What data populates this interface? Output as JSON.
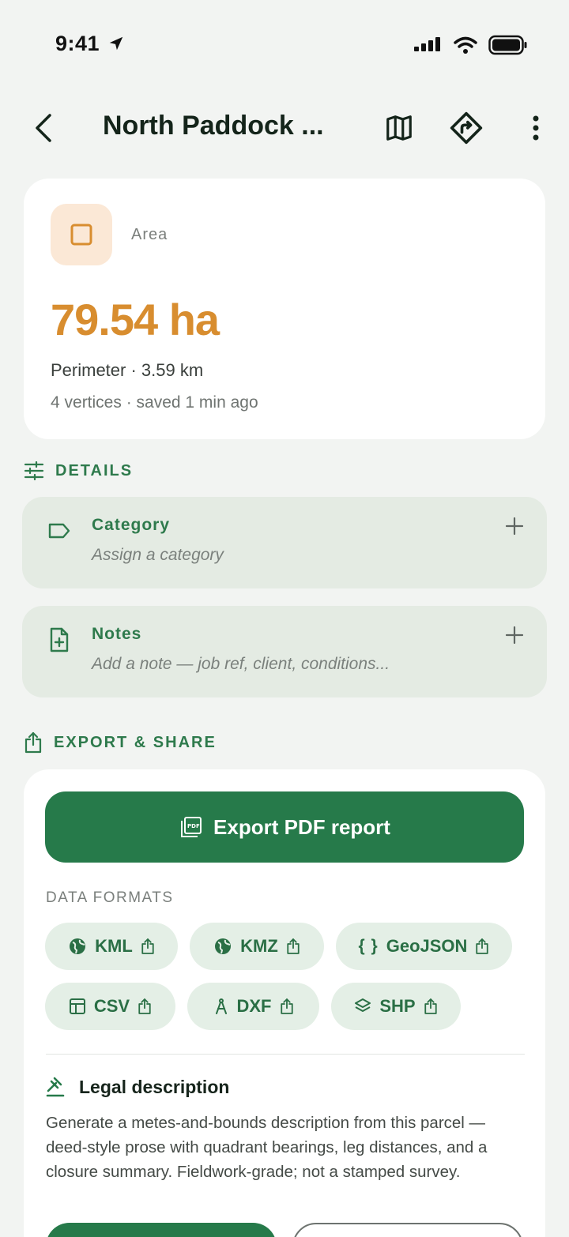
{
  "status": {
    "time": "9:41"
  },
  "header": {
    "title": "North Paddock ..."
  },
  "summary": {
    "label": "Area",
    "value": "79.54 ha",
    "perimeter": "Perimeter · 3.59 km",
    "meta": "4 vertices · saved 1 min ago"
  },
  "details": {
    "heading": "DETAILS",
    "category": {
      "title": "Category",
      "placeholder": "Assign a category"
    },
    "notes": {
      "title": "Notes",
      "placeholder": "Add a note — job ref, client, conditions..."
    }
  },
  "export": {
    "heading": "EXPORT & SHARE",
    "pdf_label": "Export PDF report",
    "formats_label": "DATA FORMATS",
    "formats": [
      "KML",
      "KMZ",
      "GeoJSON",
      "CSV",
      "DXF",
      "SHP"
    ],
    "legal_title": "Legal description",
    "legal_text": "Generate a metes-and-bounds description from this parcel — deed-style prose with quadrant bearings, leg distances, and a closure summary. Fieldwork-grade; not a stamped survey."
  },
  "colors": {
    "accent_green": "#267a4a",
    "area_orange": "#d88d2f",
    "background": "#f2f4f2"
  }
}
